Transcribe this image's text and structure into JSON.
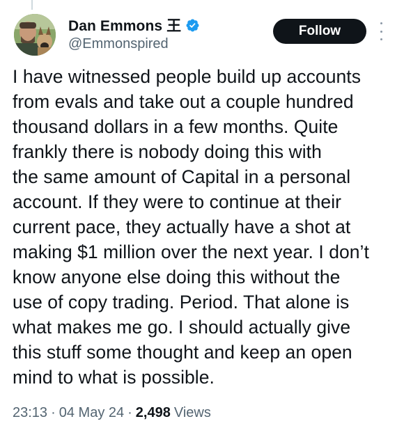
{
  "author": {
    "display_name": "Dan Emmons 王",
    "handle": "@Emmonspired",
    "verified": true,
    "verified_icon": "verified-badge-icon",
    "avatar_icon": "avatar-man-with-dog"
  },
  "actions": {
    "follow_label": "Follow",
    "more_icon": "more-vertical-icon"
  },
  "tweet": {
    "text": "I have witnessed people build up accounts\nfrom evals and take out a couple hundred\nthousand dollars in a few months. Quite\nfrankly there is nobody doing this with\nthe same amount of Capital in a personal\naccount. If they were to continue at their\ncurrent pace, they actually have a shot at\nmaking $1 million over the next year. I don’t\nknow anyone else doing this without the\nuse of copy trading. Period. That alone is\nwhat makes me go. I should actually give\nthis stuff some thought and keep an open\nmind to what is possible."
  },
  "meta": {
    "time": "23:13",
    "separator": "·",
    "date": "04 May 24",
    "views_count": "2,498",
    "views_label": "Views"
  },
  "colors": {
    "text_primary": "#0f1419",
    "text_secondary": "#536471",
    "verified_blue": "#1d9bf0",
    "follow_bg": "#0f1419",
    "follow_text": "#ffffff"
  }
}
